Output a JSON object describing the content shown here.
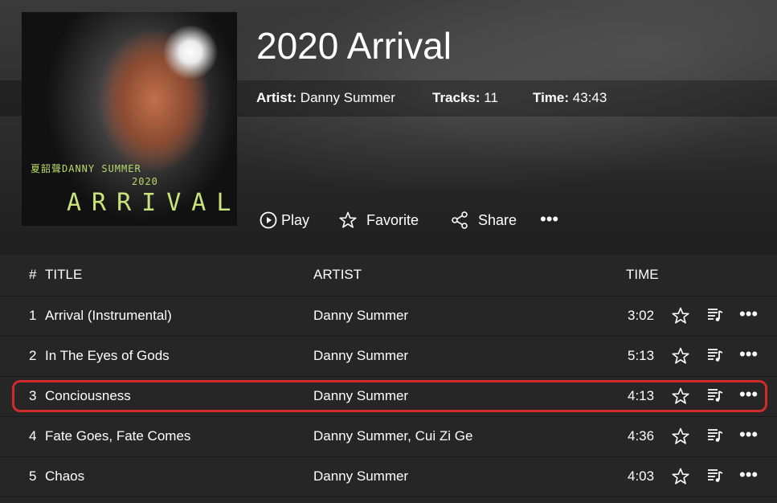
{
  "album": {
    "title": "2020 Arrival",
    "cover": {
      "artist_line": "夏韶聲DANNY SUMMER",
      "year": "2020",
      "word": "ARRIVAL"
    },
    "meta": {
      "artist_label": "Artist:",
      "artist_value": "Danny Summer",
      "tracks_label": "Tracks:",
      "tracks_value": "11",
      "time_label": "Time:",
      "time_value": "43:43"
    }
  },
  "actions": {
    "play": "Play",
    "favorite": "Favorite",
    "share": "Share",
    "more": "•••"
  },
  "table": {
    "headers": {
      "num": "#",
      "title": "TITLE",
      "artist": "ARTIST",
      "time": "TIME"
    },
    "rows": [
      {
        "num": "1",
        "title": "Arrival (Instrumental)",
        "artist": "Danny Summer",
        "time": "3:02"
      },
      {
        "num": "2",
        "title": "In The Eyes of Gods",
        "artist": "Danny Summer",
        "time": "5:13"
      },
      {
        "num": "3",
        "title": "Conciousness",
        "artist": "Danny Summer",
        "time": "4:13"
      },
      {
        "num": "4",
        "title": "Fate Goes, Fate Comes",
        "artist": "Danny Summer, Cui Zi Ge",
        "time": "4:36"
      },
      {
        "num": "5",
        "title": "Chaos",
        "artist": "Danny Summer",
        "time": "4:03"
      }
    ],
    "row_more": "•••"
  },
  "icons": {
    "play": "play-circle-icon",
    "favorite": "star-outline-icon",
    "share": "share-icon",
    "more": "more-horizontal-icon",
    "add_to_queue": "playlist-add-icon"
  },
  "colors": {
    "background": "#262626",
    "highlight": "#d12b2b",
    "cover_text": "#c8e37a"
  }
}
